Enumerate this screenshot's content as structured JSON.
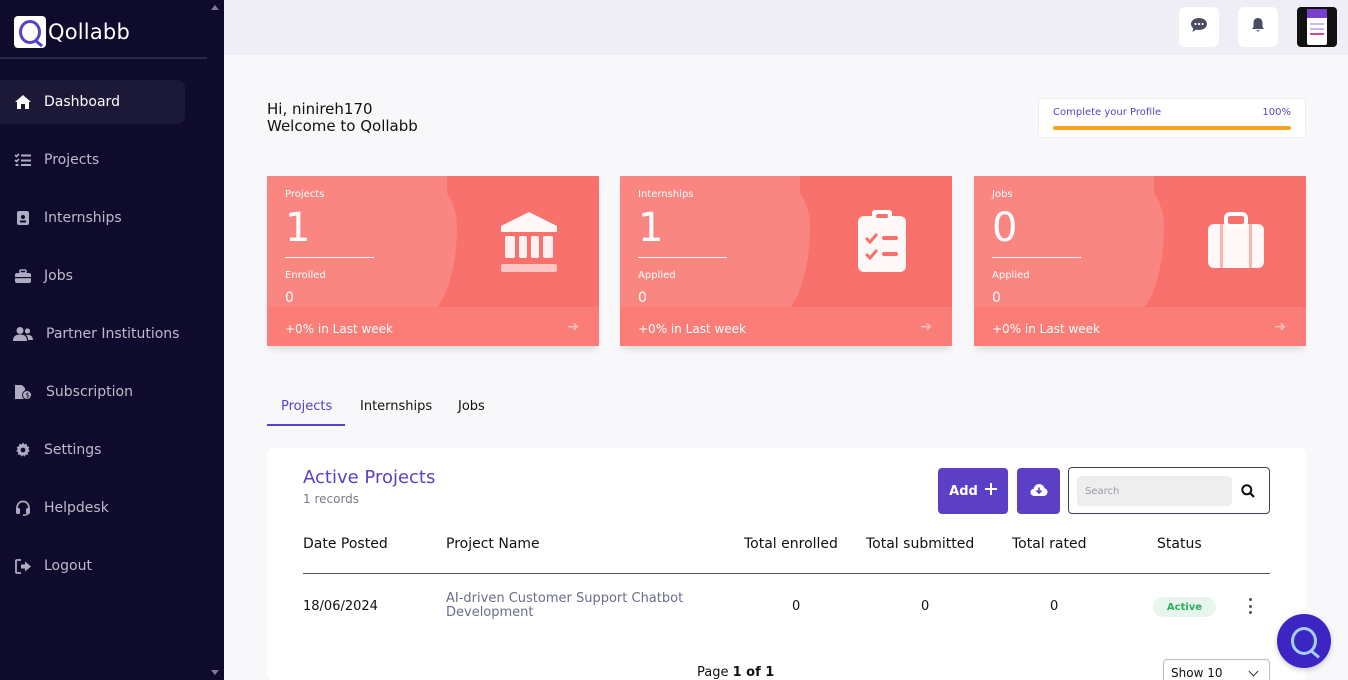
{
  "brand": {
    "name": "Qollabb"
  },
  "sidebar": {
    "items": [
      {
        "label": "Dashboard",
        "icon": "home-icon",
        "active": true
      },
      {
        "label": "Projects",
        "icon": "task-list-icon"
      },
      {
        "label": "Internships",
        "icon": "id-badge-icon"
      },
      {
        "label": "Jobs",
        "icon": "briefcase-icon"
      },
      {
        "label": "Partner Institutions",
        "icon": "users-icon"
      },
      {
        "label": "Subscription",
        "icon": "file-dollar-icon"
      },
      {
        "label": "Settings",
        "icon": "gear-icon"
      },
      {
        "label": "Helpdesk",
        "icon": "headset-icon"
      },
      {
        "label": "Logout",
        "icon": "logout-icon"
      }
    ]
  },
  "topbar": {
    "icons": [
      "chat-icon",
      "bell-icon"
    ],
    "avatar": "user-avatar"
  },
  "greeting": {
    "line1": "Hi, ninireh170",
    "line2": "Welcome to Qollabb"
  },
  "profile": {
    "label": "Complete your Profile",
    "percent_text": "100%",
    "percent": 100,
    "bar_color": "#f6a21e"
  },
  "stats": [
    {
      "label": "Projects",
      "value": "1",
      "sub_label": "Enrolled",
      "sub_value": "0",
      "trend": "+0% in Last week",
      "icon": "institution-icon"
    },
    {
      "label": "Internships",
      "value": "1",
      "sub_label": "Applied",
      "sub_value": "0",
      "trend": "+0% in Last week",
      "icon": "clipboard-check-icon"
    },
    {
      "label": "Jobs",
      "value": "0",
      "sub_label": "Applied",
      "sub_value": "0",
      "trend": "+0% in Last week",
      "icon": "briefcase-icon"
    }
  ],
  "tabs": [
    {
      "label": "Projects",
      "active": true
    },
    {
      "label": "Internships"
    },
    {
      "label": "Jobs"
    }
  ],
  "table_panel": {
    "title": "Active Projects",
    "count": "1 records",
    "add_label": "Add",
    "search_placeholder": "Search",
    "columns": [
      "Date Posted",
      "Project Name",
      "Total enrolled",
      "Total submitted",
      "Total rated",
      "Status"
    ],
    "rows": [
      {
        "date": "18/06/2024",
        "name": "AI-driven Customer Support Chatbot Development",
        "enrolled": "0",
        "submitted": "0",
        "rated": "0",
        "status": "Active"
      }
    ],
    "pager": {
      "prefix": "Page ",
      "current": "1 of 1"
    },
    "page_size": "Show 10"
  },
  "colors": {
    "brand": "#5b3fc4",
    "sidebar": "#0f0b2c",
    "card": "#f8716c",
    "status_active": "#2bae5c"
  }
}
